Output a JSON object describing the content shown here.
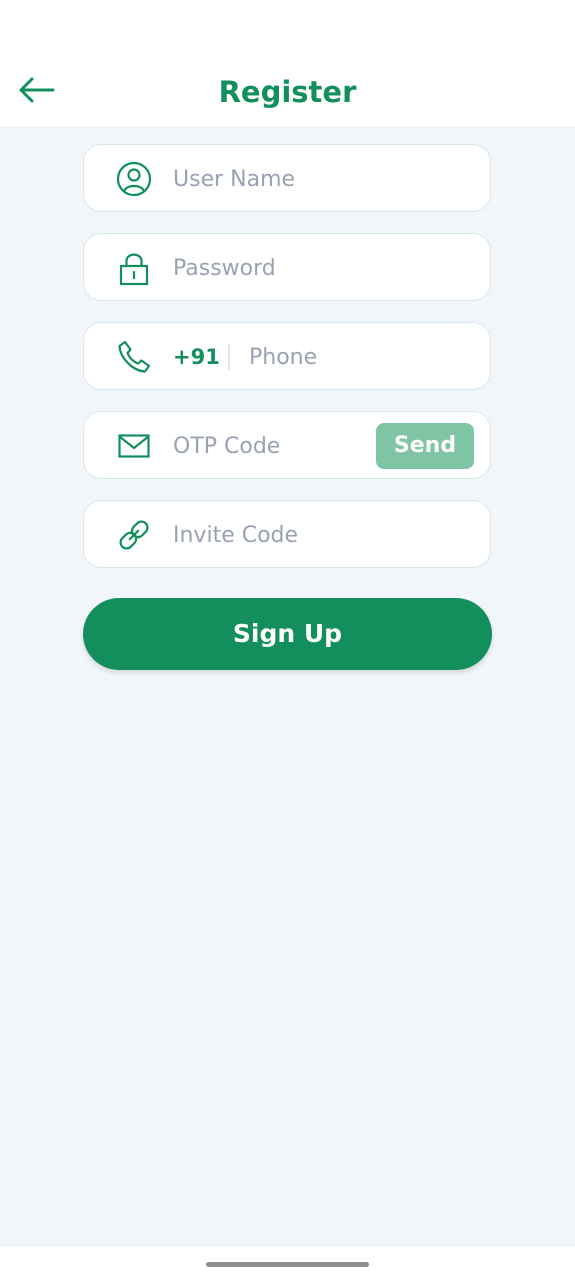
{
  "header": {
    "title": "Register",
    "back_icon": "arrow-left-icon"
  },
  "form": {
    "username": {
      "placeholder": "User Name",
      "icon": "user-icon"
    },
    "password": {
      "placeholder": "Password",
      "icon": "lock-icon"
    },
    "phone": {
      "country_code": "+91",
      "placeholder": "Phone",
      "icon": "phone-icon"
    },
    "otp": {
      "placeholder": "OTP Code",
      "icon": "mail-icon",
      "send_label": "Send"
    },
    "invite": {
      "placeholder": "Invite Code",
      "icon": "link-icon"
    }
  },
  "signup_label": "Sign Up",
  "colors": {
    "accent": "#128f5c",
    "accent_light": "#80c4a6",
    "background": "#f2f6fb",
    "field_border": "#d7e8ec",
    "placeholder": "#98a2b3"
  }
}
